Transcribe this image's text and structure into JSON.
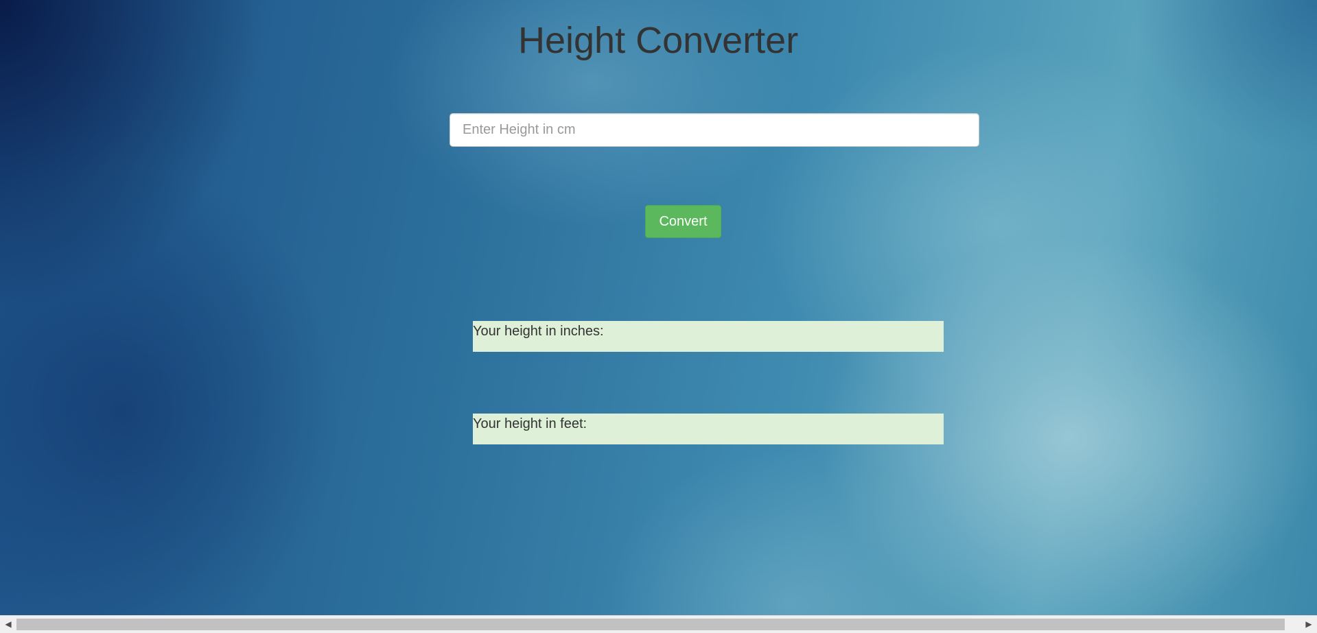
{
  "header": {
    "title": "Height Converter"
  },
  "form": {
    "height_input": {
      "placeholder": "Enter Height in cm",
      "value": ""
    },
    "convert_label": "Convert"
  },
  "results": {
    "inches_label": "Your height in inches:",
    "feet_label": "Your height in feet:"
  },
  "scrollbar": {
    "left_arrow": "arrow-left-icon",
    "right_arrow": "arrow-right-icon"
  },
  "colors": {
    "button": "#5cb85c",
    "result_background": "#dff0d8",
    "text": "#333333"
  }
}
